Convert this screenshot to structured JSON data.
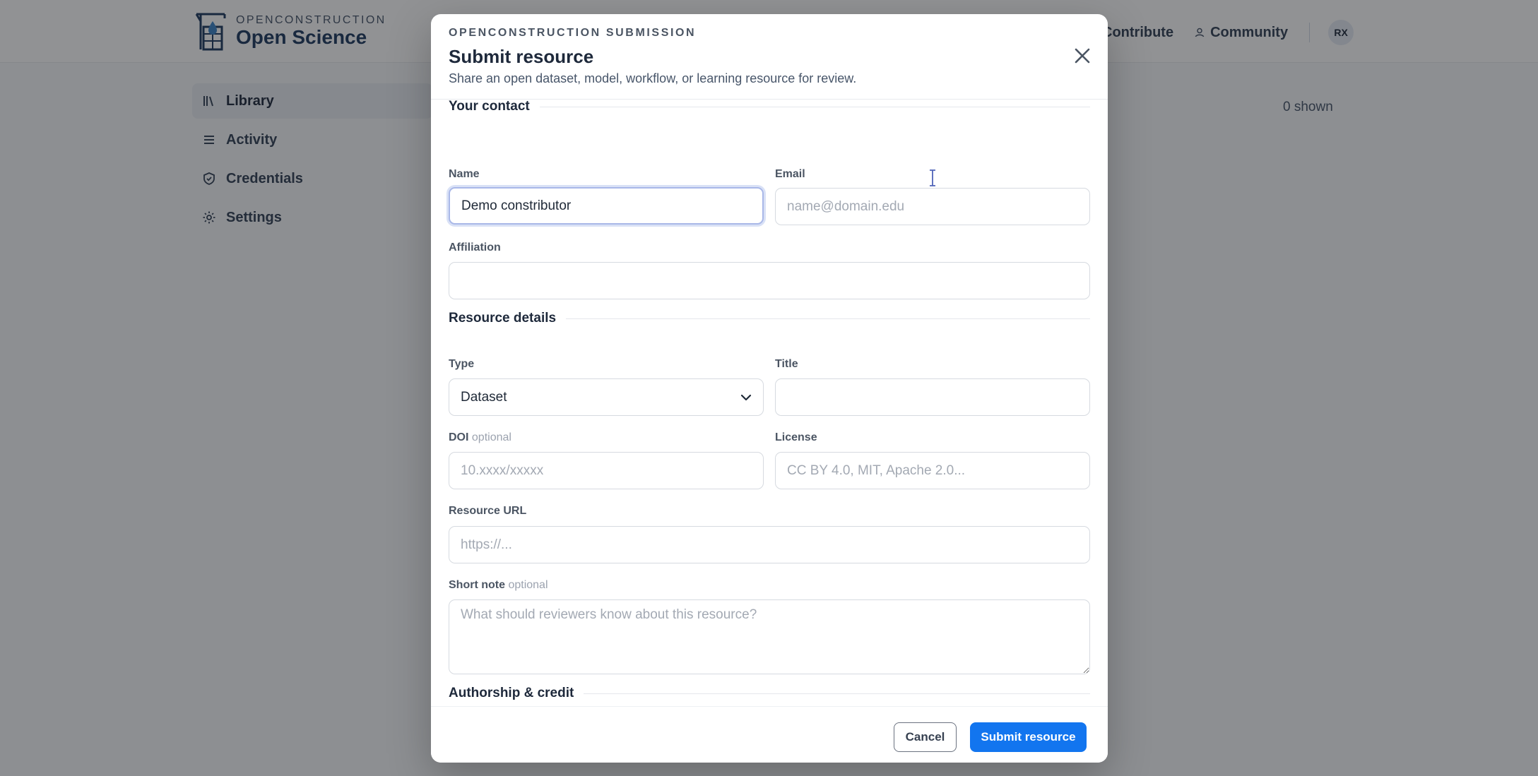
{
  "brand": {
    "kicker": "OPENCONSTRUCTION",
    "name": "Open Science",
    "logo_icon": "crane-building-icon"
  },
  "topnav": {
    "items": [
      {
        "label": "Contribute",
        "icon": "upload-icon"
      },
      {
        "label": "Community",
        "icon": "person-icon"
      }
    ],
    "avatar_initials": "RX"
  },
  "sidebar": {
    "items": [
      {
        "label": "Library",
        "icon": "library-icon",
        "active": true
      },
      {
        "label": "Activity",
        "icon": "list-icon",
        "active": false
      },
      {
        "label": "Credentials",
        "icon": "shield-icon",
        "active": false
      },
      {
        "label": "Settings",
        "icon": "gear-icon",
        "active": false
      }
    ]
  },
  "library": {
    "shown_count": "0 shown"
  },
  "modal": {
    "kicker": "OPENCONSTRUCTION SUBMISSION",
    "title": "Submit resource",
    "subtitle": "Share an open dataset, model, workflow, or learning resource for review.",
    "sections": {
      "contact": "Your contact",
      "details": "Resource details",
      "authorship": "Authorship & credit"
    },
    "fields": {
      "name": {
        "label": "Name",
        "value": "Demo constributor",
        "placeholder": ""
      },
      "email": {
        "label": "Email",
        "value": "",
        "placeholder": "name@domain.edu"
      },
      "affiliation": {
        "label": "Affiliation",
        "value": "",
        "placeholder": ""
      },
      "type": {
        "label": "Type",
        "value": "Dataset"
      },
      "title": {
        "label": "Title",
        "value": "",
        "placeholder": ""
      },
      "doi": {
        "label": "DOI",
        "optional": "optional",
        "value": "",
        "placeholder": "10.xxxx/xxxxx"
      },
      "license": {
        "label": "License",
        "value": "",
        "placeholder": "CC BY 4.0, MIT, Apache 2.0..."
      },
      "url": {
        "label": "Resource URL",
        "value": "",
        "placeholder": "https://..."
      },
      "note": {
        "label": "Short note",
        "optional": "optional",
        "value": "",
        "placeholder": "What should reviewers know about this resource?"
      }
    },
    "buttons": {
      "cancel": "Cancel",
      "submit": "Submit resource"
    }
  },
  "colors": {
    "primary": "#1275ef",
    "brand_navy": "#1e3a5f",
    "overlay": "rgba(20,22,26,0.46)",
    "focus_ring": "#a9b8e8"
  }
}
